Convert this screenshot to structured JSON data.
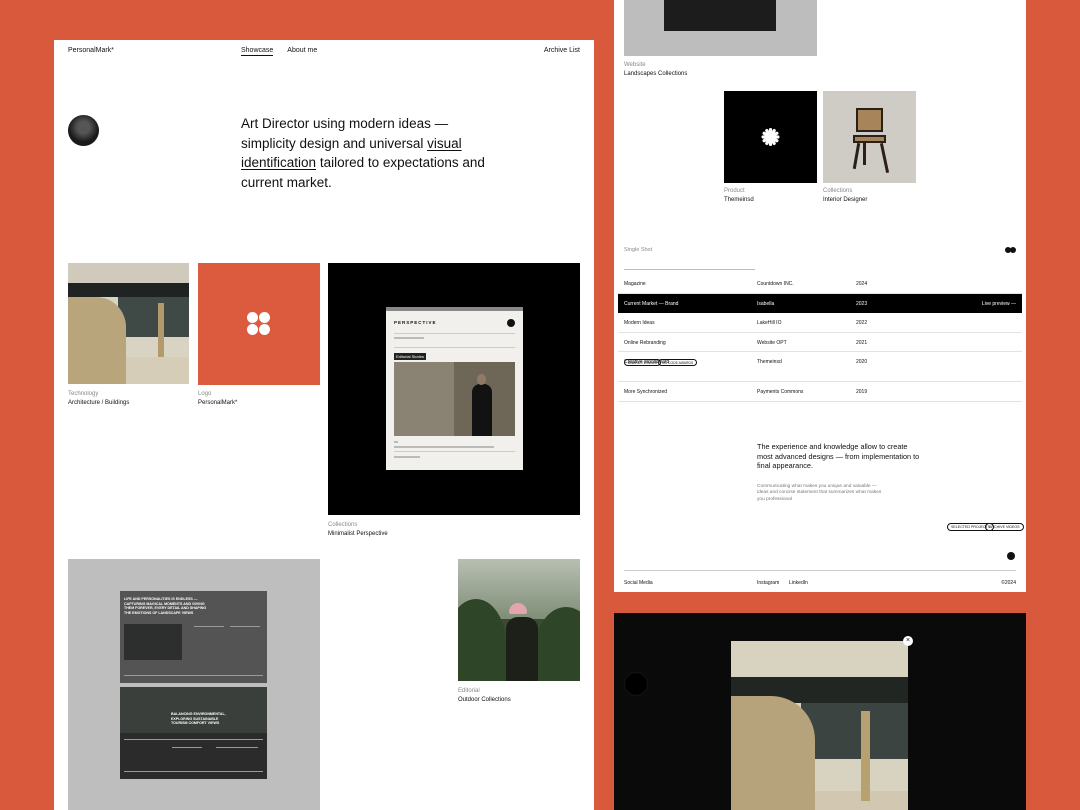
{
  "nav": {
    "brand": "PersonalMark*",
    "links": [
      "Showcase",
      "About me"
    ],
    "archive": "Archive List"
  },
  "hero": {
    "line_pre": "Art Director using modern ideas — simplicity design and universal ",
    "link": "visual identification",
    "line_post": " tailored to expectations and current market."
  },
  "works": [
    {
      "category": "Technology",
      "title": "Architecture / Buildings"
    },
    {
      "category": "Logo",
      "title": "PersonalMark*"
    },
    {
      "category": "Collections",
      "title": "Minimalist Perspective"
    },
    {
      "category": "Editorial",
      "title": "Outdoor Collections"
    }
  ],
  "magazine": {
    "title": "PERSPECTIVE",
    "tag": "Editorial Stories"
  },
  "spread": {
    "headline": "LIFE AND PERSONALITIES IS ENDLESS — CAPTURING MAGICAL MOMENTS AND GIVING THEM FOREVER, EVERY DETAIL AND SHAPING THE EMOTIONS OF LANDSCAPE VIEWS",
    "headline2": "BALANCING ENVIRONMENTAL, EXPLORING SUSTAINABLE TOURISM COMFORT VIEWS"
  },
  "right": {
    "top_item": {
      "category": "Website",
      "title": "Landscapes Collections"
    },
    "product": {
      "category": "Product",
      "title": "Themeinsd"
    },
    "chair": {
      "category": "Collections",
      "title": "Interior Designer"
    },
    "section_label": "Single Shot",
    "table": [
      {
        "project": "Magazine",
        "client": "Countdown INC.",
        "year": "2024",
        "action": ""
      },
      {
        "project": "Current Market — Brand",
        "client": "Isabella",
        "year": "2023",
        "action": "Live preview —"
      },
      {
        "project": "Modern Ideas",
        "client": "LakeHill IO",
        "year": "2022",
        "action": ""
      },
      {
        "project": "Online Rebranding",
        "client": "Website OPT",
        "year": "2021",
        "action": ""
      },
      {
        "project": "Creative Moodboard",
        "client": "Themeinsd",
        "year": "2020",
        "action": ""
      },
      {
        "project": "More Synchronized",
        "client": "Payments Commons",
        "year": "2019",
        "action": ""
      }
    ],
    "chips": [
      "AWARDS WINNER",
      "NO CODE AWARDS"
    ],
    "statement": "The experience and knowledge allow to create most advanced designs — from implementation to final appearance.",
    "statement_sub": "Communicating what makes you unique and valuable — ideas and concise statement that summarizes what makes you professional",
    "buttons": [
      "SELECTED PROJECTS",
      "ARCHIVE VIDEOS"
    ],
    "footer": {
      "left": "Social Media",
      "links": [
        "Instagram",
        "LinkedIn"
      ],
      "copyright": "©2024"
    }
  },
  "dark": {
    "close_icon": "×"
  }
}
